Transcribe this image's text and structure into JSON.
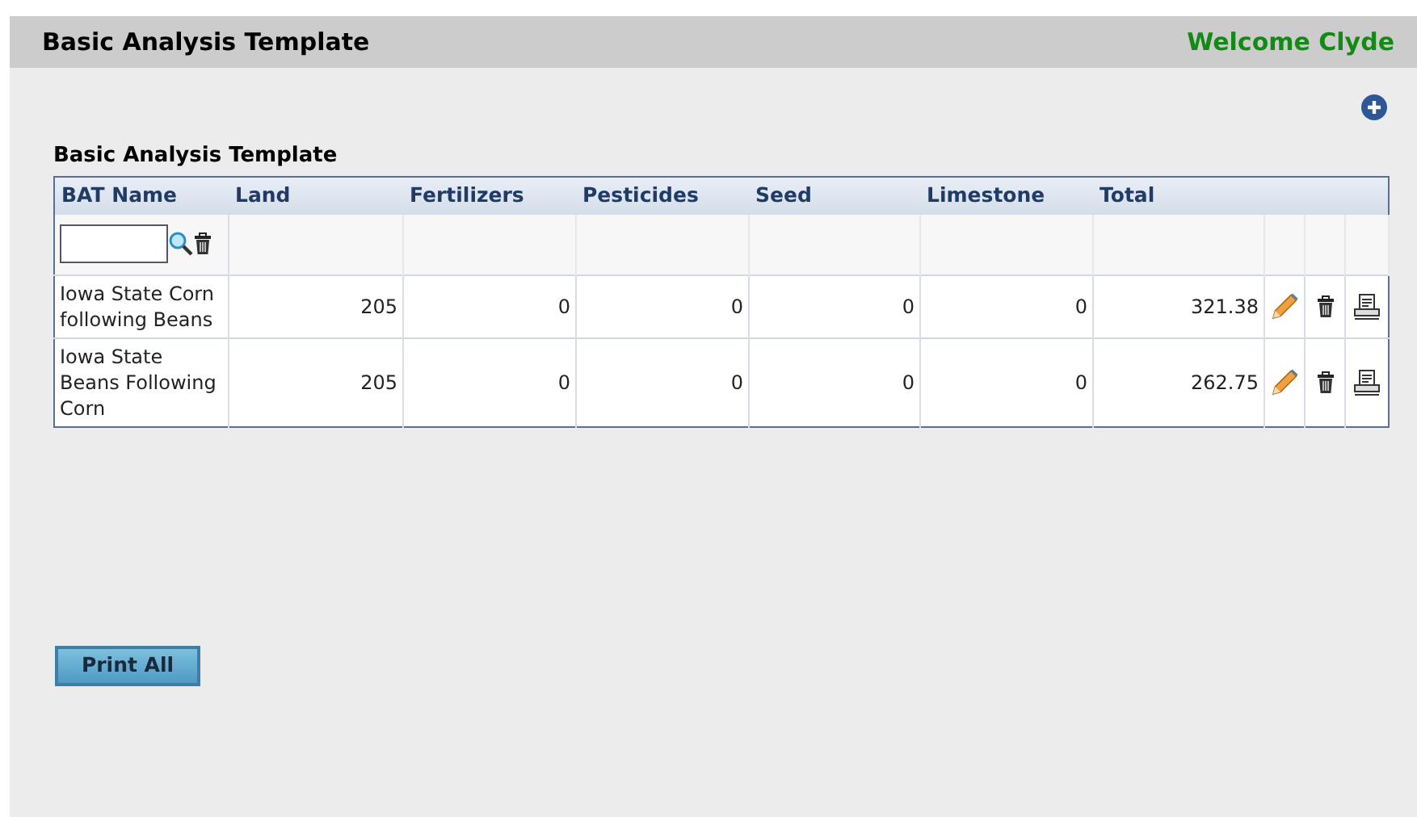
{
  "header": {
    "title": "Basic Analysis Template",
    "welcome": "Welcome Clyde"
  },
  "section_title": "Basic Analysis Template",
  "table": {
    "columns": [
      "BAT Name",
      "Land",
      "Fertilizers",
      "Pesticides",
      "Seed",
      "Limestone",
      "Total"
    ],
    "rows": [
      {
        "cells": [
          "Iowa State Corn following Beans",
          "205",
          "0",
          "0",
          "0",
          "0",
          "321.38"
        ]
      },
      {
        "cells": [
          "Iowa State Beans Following Corn",
          "205",
          "0",
          "0",
          "0",
          "0",
          "262.75"
        ]
      }
    ]
  },
  "print_all_button": "Print All"
}
